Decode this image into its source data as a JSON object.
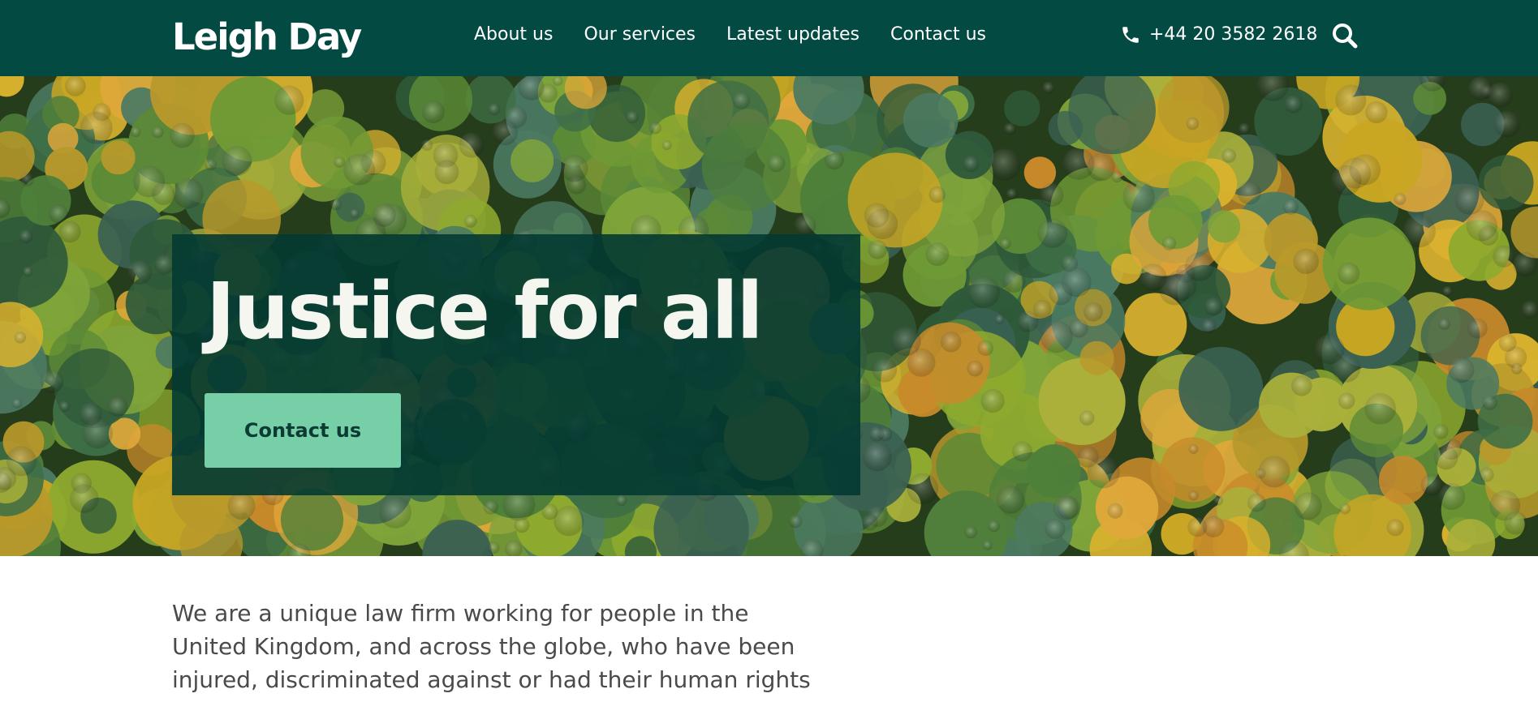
{
  "header": {
    "logo_text": "Leigh Day",
    "nav": [
      {
        "label": "About us"
      },
      {
        "label": "Our services"
      },
      {
        "label": "Latest updates"
      },
      {
        "label": "Contact us"
      }
    ],
    "phone": "+44 20 3582 2618",
    "phone_icon": "phone-icon",
    "search_icon": "search-icon",
    "background_color": "#034a43"
  },
  "hero": {
    "title": "Justice for all",
    "cta_label": "Contact us",
    "cta_color": "#76cfa6",
    "image": "aerial forest canopy"
  },
  "intro": {
    "text": "We are a unique law firm working for people in the United Kingdom, and across the globe, who have been injured, discriminated against or had their human rights abused."
  }
}
